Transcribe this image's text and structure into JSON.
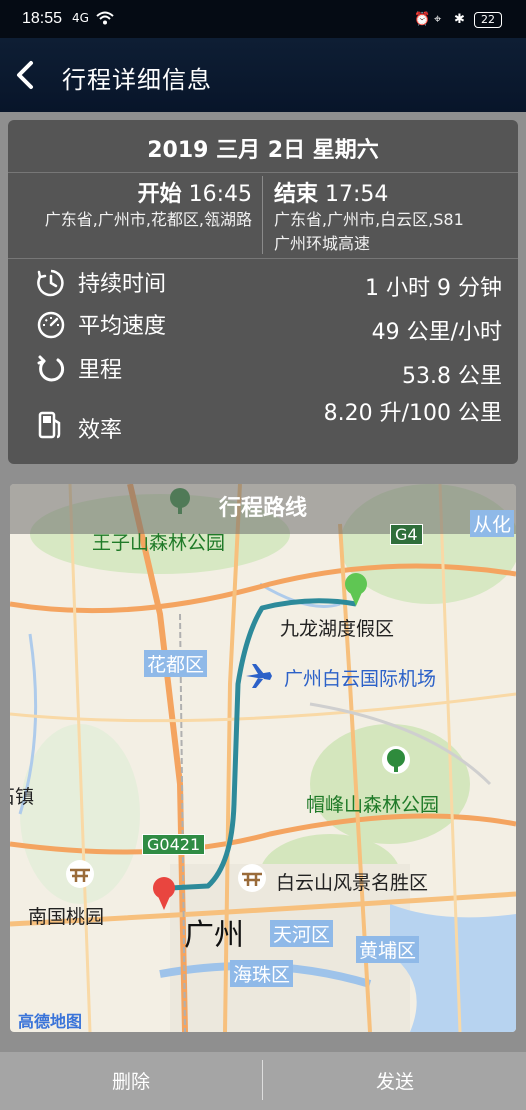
{
  "status_bar": {
    "time": "18:55",
    "signal": "4G",
    "battery": "22"
  },
  "app_bar": {
    "title": "行程详细信息"
  },
  "trip": {
    "date": "2019 三月 2日 星期六",
    "start_label": "开始",
    "start_time": "16:45",
    "start_address": "广东省,广州市,花都区,瓴湖路",
    "end_label": "结束",
    "end_time": "17:54",
    "end_address": "广东省,广州市,白云区,S81广州环城高速",
    "stats": [
      {
        "icon": "timer-icon",
        "label": "持续时间",
        "value": "1 小时 9 分钟"
      },
      {
        "icon": "speedometer-icon",
        "label": "平均速度",
        "value": "49 公里/小时"
      },
      {
        "icon": "mileage-icon",
        "label": "里程",
        "value": "53.8 公里"
      },
      {
        "icon": "fuel-pump-icon",
        "label": "效率",
        "value": "8.20 升/100 公里"
      }
    ]
  },
  "map": {
    "title": "行程路线",
    "labels": {
      "wangzishan": "王子山森林公园",
      "g4": "G4",
      "conghua": "从化",
      "jiulonghu": "九龙湖度假区",
      "huadu": "花都区",
      "airport": "广州白云国际机场",
      "maofeng": "帽峰山森林公园",
      "zhen": "石镇",
      "g0421": "G0421",
      "baiyunshan": "白云山风景名胜区",
      "nanguo": "南国桃园",
      "guangzhou": "广州",
      "tianhe": "天河区",
      "huangpu": "黄埔区",
      "haizhu": "海珠区"
    },
    "provider_logo": "高德地图"
  },
  "bottom_bar": {
    "delete_label": "删除",
    "send_label": "发送"
  }
}
